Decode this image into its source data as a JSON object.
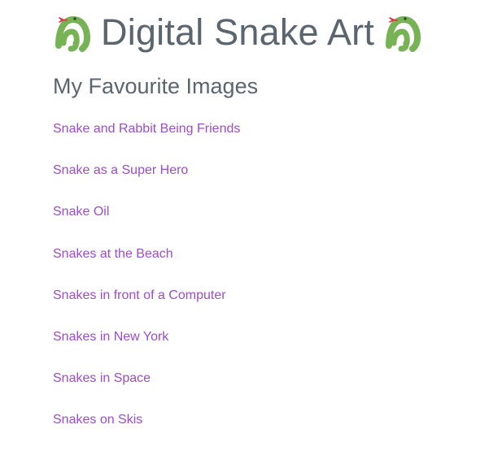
{
  "header": {
    "title": "Digital Snake Art",
    "left_icon": "snake-icon",
    "right_icon": "snake-icon"
  },
  "section": {
    "heading": "My Favourite Images"
  },
  "links": [
    "Snake and Rabbit Being Friends",
    "Snake as a Super Hero",
    "Snake Oil",
    "Snakes at the Beach",
    "Snakes in front of a Computer",
    "Snakes in New York",
    "Snakes in Space",
    "Snakes on Skis"
  ],
  "colors": {
    "title_text": "#5a6570",
    "link": "#9b4dca",
    "snake_green": "#77b255",
    "snake_tongue": "#dd2e44"
  }
}
